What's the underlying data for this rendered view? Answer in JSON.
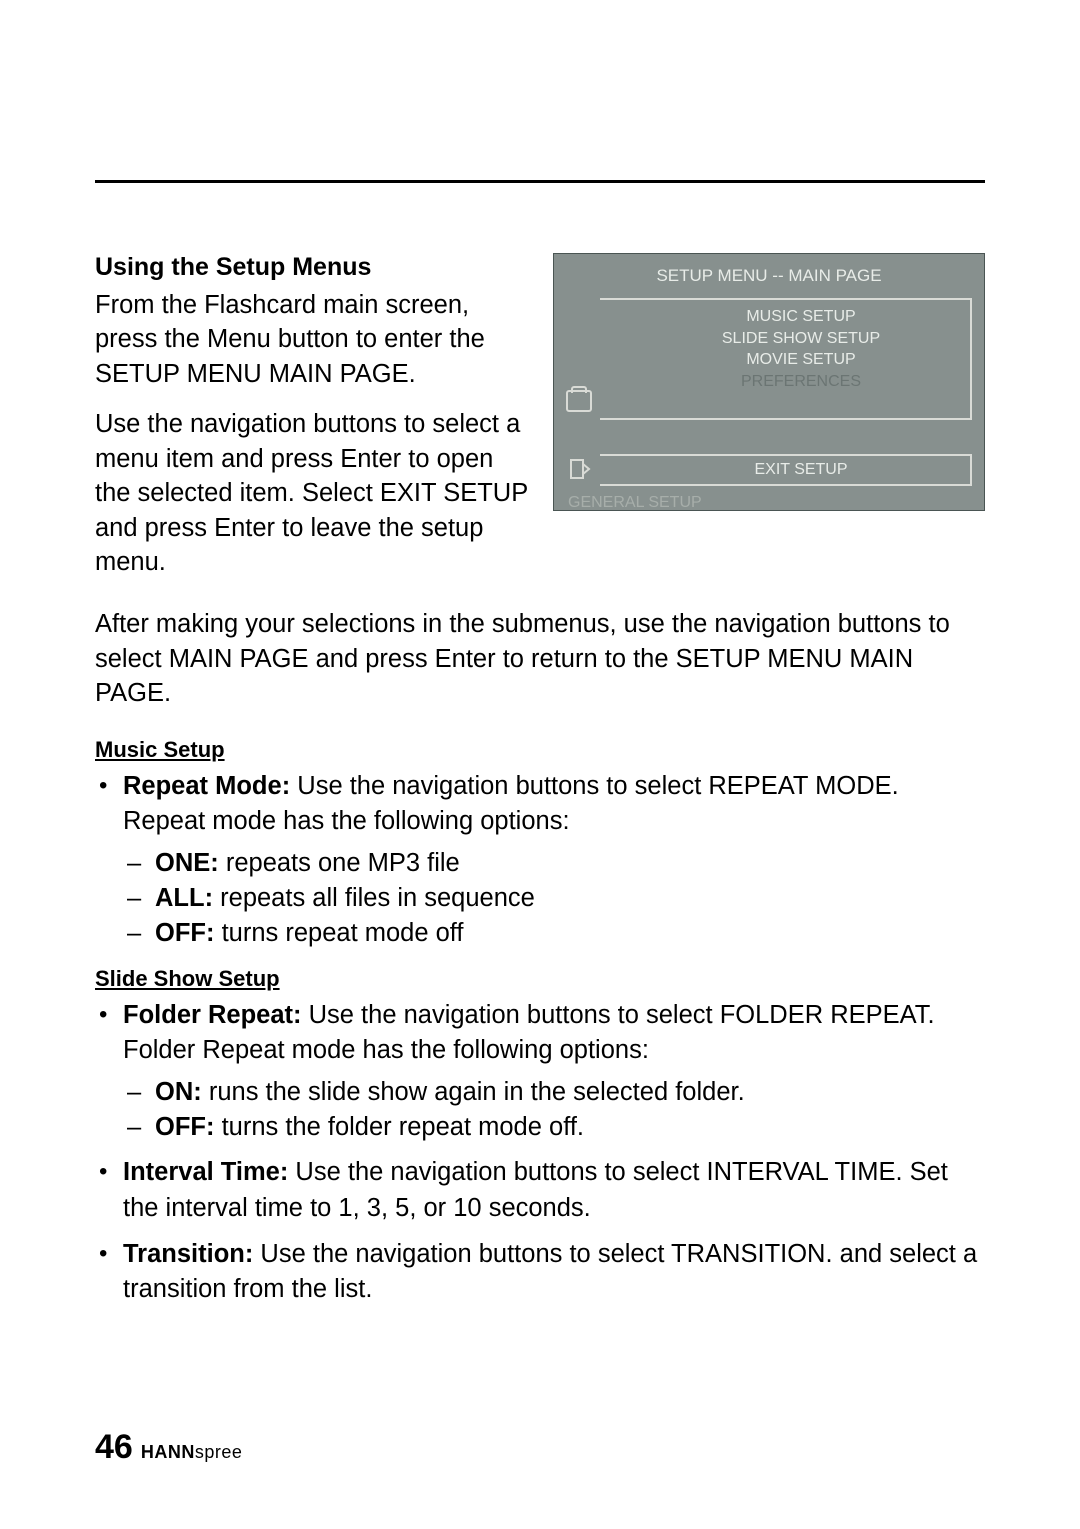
{
  "heading": "Using the Setup Menus",
  "p1": "From the Flashcard main screen, press the Menu button to enter the SETUP MENU MAIN PAGE.",
  "p2": "Use the navigation buttons to select a menu item and press Enter to open the selected item. Select EXIT SETUP and press Enter to leave the setup menu.",
  "p3": "After making your selections in the submenus, use the navigation buttons to select MAIN PAGE and press Enter to return to the SETUP MENU MAIN PAGE.",
  "menu": {
    "title": "SETUP MENU -- MAIN PAGE",
    "items": [
      "MUSIC SETUP",
      "SLIDE SHOW SETUP",
      "MOVIE SETUP",
      "PREFERENCES"
    ],
    "exit": "EXIT SETUP",
    "footer": "GENERAL SETUP"
  },
  "music": {
    "heading": "Music Setup",
    "repeat": {
      "label": "Repeat Mode:",
      "desc": " Use the navigation buttons to select REPEAT MODE. Repeat mode has the following options:",
      "opts": [
        {
          "k": "ONE:",
          "v": " repeats one MP3 file"
        },
        {
          "k": "ALL:",
          "v": " repeats all files in sequence"
        },
        {
          "k": "OFF:",
          "v": " turns repeat mode off"
        }
      ]
    }
  },
  "slide": {
    "heading": "Slide Show Setup",
    "folder": {
      "label": "Folder Repeat:",
      "desc": " Use the navigation buttons to select FOLDER REPEAT. Folder Repeat mode has the following options:",
      "opts": [
        {
          "k": "ON:",
          "v": " runs the slide show again in the selected folder."
        },
        {
          "k": "OFF:",
          "v": " turns the folder repeat mode off."
        }
      ]
    },
    "interval": {
      "label": "Interval Time:",
      "desc": " Use the navigation buttons to select INTERVAL TIME. Set the interval time to 1, 3, 5, or 10 seconds."
    },
    "transition": {
      "label": "Transition:",
      "desc": " Use the navigation buttons to select TRANSITION. and select a transition from the list."
    }
  },
  "footer": {
    "page": "46",
    "brand1": "HANN",
    "brand2": "spree"
  }
}
